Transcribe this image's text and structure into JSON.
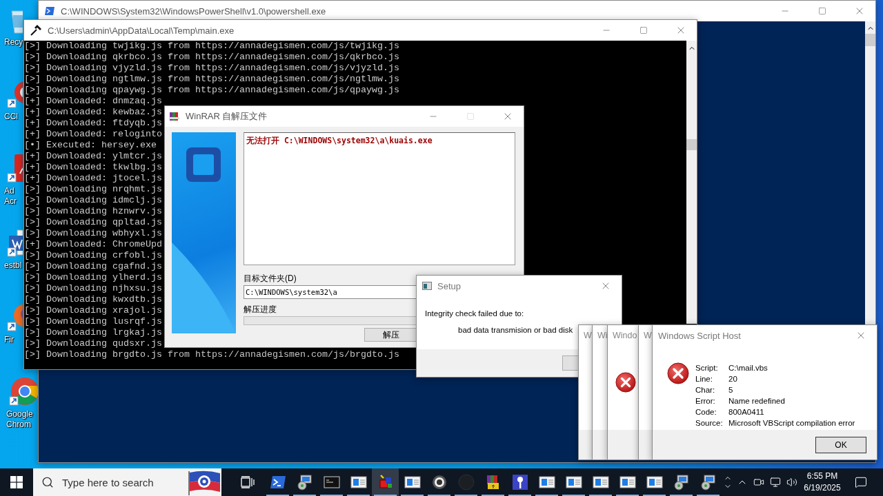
{
  "desktop_icons": [
    {
      "kind": "recycle",
      "label": [
        "Recy"
      ]
    },
    {
      "kind": "cleaner",
      "label": [
        "CCl"
      ]
    },
    {
      "kind": "pdf",
      "label": [
        "Ad",
        "Acr"
      ]
    },
    {
      "kind": "document",
      "label": [
        "estbl"
      ]
    },
    {
      "kind": "firefox",
      "label": [
        "Fir"
      ]
    },
    {
      "kind": "chrome",
      "label": [
        "Google",
        "Chrom"
      ]
    }
  ],
  "powershell": {
    "title": "C:\\WINDOWS\\System32\\WindowsPowerShell\\v1.0\\powershell.exe"
  },
  "console": {
    "title": "C:\\Users\\admin\\AppData\\Local\\Temp\\main.exe",
    "lines": [
      "[>] Downloading twjikg.js from https://annadegismen.com/js/twjikg.js",
      "[>] Downloading qkrbco.js from https://annadegismen.com/js/qkrbco.js",
      "[>] Downloading vjyzld.js from https://annadegismen.com/js/vjyzld.js",
      "[>] Downloading ngtlmw.js from https://annadegismen.com/js/ngtlmw.js",
      "[>] Downloading qpaywg.js from https://annadegismen.com/js/qpaywg.js",
      "[+] Downloaded: dnmzaq.js",
      "[+] Downloaded: kewbaz.js",
      "[+] Downloaded: ftdyqb.js",
      "[+] Downloaded: reloginto",
      "[•] Executed: hersey.exe",
      "[+] Downloaded: ylmtcr.js",
      "[+] Downloaded: tkwlbg.js",
      "[+] Downloaded: jtocel.js",
      "[>] Downloading nrqhmt.js",
      "[>] Downloading idmclj.js",
      "[>] Downloading hznwrv.js",
      "[>] Downloading qpltad.js",
      "[>] Downloading wbhyxl.js",
      "[+] Downloaded: ChromeUpd",
      "[>] Downloading crfobl.js",
      "[>] Downloading cgafnd.js",
      "[>] Downloading ylherd.js",
      "[>] Downloading njhxsu.js",
      "[>] Downloading kwxdtb.js",
      "[>] Downloading xrajol.js",
      "[>] Downloading lusrqf.js",
      "[>] Downloading lrgkaj.js",
      "[>] Downloading qudsxr.js",
      "[>] Downloading brgdto.js from https://annadegismen.com/js/brgdto.js"
    ]
  },
  "winrar": {
    "title": "WinRAR 自解压文件",
    "maximize_disabled": true,
    "message": "无法打开 C:\\WINDOWS\\system32\\a\\kuais.exe",
    "folder_label": "目标文件夹(D)",
    "folder_value": "C:\\WINDOWS\\system32\\a",
    "progress_label": "解压进度",
    "progress": {
      "level": 0
    },
    "extract_button": "解压"
  },
  "setup": {
    "title": "Setup",
    "lines": [
      "Integrity check failed due to:",
      "bad data transmision or bad disk"
    ]
  },
  "script_host_stack": [
    {
      "title": "W",
      "error_icon": false
    },
    {
      "title": "Wi",
      "error_icon": false
    },
    {
      "title": "Windo",
      "error_icon": true
    },
    {
      "title": "W",
      "error_icon": false
    }
  ],
  "script_host": {
    "title": "Windows Script Host",
    "details": [
      {
        "key": "Script:",
        "value": "C:\\mail.vbs"
      },
      {
        "key": "Line:",
        "value": "20"
      },
      {
        "key": "Char:",
        "value": "5"
      },
      {
        "key": "Error:",
        "value": "Name redefined"
      },
      {
        "key": "Code:",
        "value": "800A0411"
      },
      {
        "key": "Source:",
        "value": "Microsoft VBScript compilation error"
      }
    ],
    "ok_button": "OK"
  },
  "taskbar": {
    "search_placeholder": "Type here to search",
    "apps": [
      {
        "kind": "terminal",
        "running": true,
        "selected": false
      },
      {
        "kind": "setup",
        "running": true,
        "selected": false
      },
      {
        "kind": "console",
        "running": true,
        "selected": false
      },
      {
        "kind": "window",
        "running": true,
        "selected": false
      },
      {
        "kind": "cubes",
        "running": true,
        "selected": true
      },
      {
        "kind": "window",
        "running": true,
        "selected": false
      },
      {
        "kind": "disc",
        "running": true,
        "selected": false
      },
      {
        "kind": "dark",
        "running": true,
        "selected": false
      },
      {
        "kind": "books",
        "running": true,
        "selected": false
      },
      {
        "kind": "key",
        "running": true,
        "selected": false
      },
      {
        "kind": "window",
        "running": true,
        "selected": false
      },
      {
        "kind": "window",
        "running": true,
        "selected": false
      },
      {
        "kind": "window",
        "running": true,
        "selected": false
      },
      {
        "kind": "window",
        "running": true,
        "selected": false
      },
      {
        "kind": "window",
        "running": true,
        "selected": false
      },
      {
        "kind": "setup",
        "running": true,
        "selected": false
      },
      {
        "kind": "setup",
        "running": true,
        "selected": false
      }
    ],
    "clock": {
      "time": "6:55 PM",
      "date": "6/19/2025"
    }
  }
}
